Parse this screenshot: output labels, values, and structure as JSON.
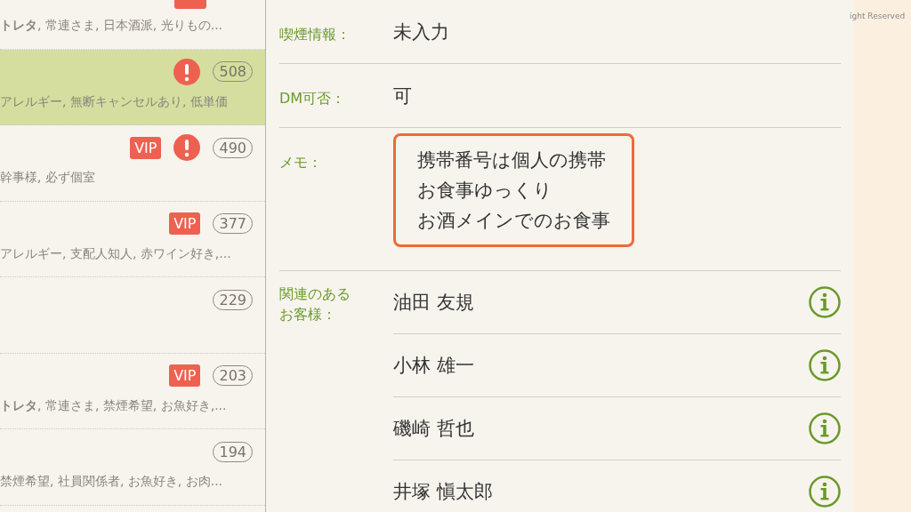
{
  "customer_list": [
    {
      "badge_cut": true,
      "alert": false,
      "selected": false,
      "tags": "**トレタ**, 常連さま, 日本酒派, 光りもの..."
    },
    {
      "alert": true,
      "selected": true,
      "count": "508",
      "tags": "アレルギー, 無断キャンセルあり, 低単価"
    },
    {
      "badge": "VIP",
      "alert": true,
      "selected": false,
      "count": "490",
      "tags": "幹事様, 必ず個室"
    },
    {
      "badge": "VIP",
      "alert": false,
      "selected": false,
      "count": "377",
      "tags": "アレルギー, 支配人知人, 赤ワイン好き,..."
    },
    {
      "alert": false,
      "selected": false,
      "count": "229"
    },
    {
      "badge": "VIP",
      "alert": false,
      "selected": false,
      "count": "203",
      "tags": "**トレタ**, 常連さま, 禁煙希望, お魚好き,..."
    },
    {
      "alert": false,
      "selected": false,
      "count": "194",
      "tags": "禁煙希望, 社員関係者, お魚好き, お肉..."
    }
  ],
  "details": [
    {
      "label": "喫煙情報：",
      "value": "未入力"
    },
    {
      "label": "DM可否：",
      "value": "可"
    }
  ],
  "memo": {
    "label": "メモ：",
    "lines": [
      "携帯番号は個人の携帯",
      "お食事ゆっくり",
      "お酒メインでのお食事"
    ]
  },
  "related": {
    "label_lines": [
      "関連のある",
      "お客様："
    ],
    "customers": [
      "油田 友規",
      "小林 雄一",
      "磯崎 哲也",
      "井塚 愼太郎"
    ]
  },
  "copyright": "ight Reserved"
}
